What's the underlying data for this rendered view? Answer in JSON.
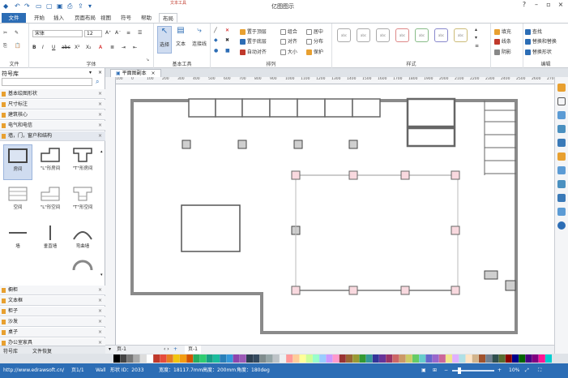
{
  "app_title": "亿图图示",
  "context_tab": "文本工具",
  "menu_tabs": [
    "文件",
    "开始",
    "插入",
    "页面布局",
    "视图",
    "符号",
    "帮助",
    "布局"
  ],
  "ribbon": {
    "font_name": "宋体",
    "font_size": "12",
    "groups": [
      "文件",
      "字体",
      "基本工具",
      "排列",
      "样式",
      "编辑"
    ],
    "tools": [
      "选择",
      "文本",
      "连接线"
    ],
    "arrange": [
      "置于顶层",
      "置于底层",
      "自动对齐"
    ],
    "arrange2": [
      "组合",
      "对齐",
      "大小"
    ],
    "arrange3": [
      "居中",
      "分布",
      "保护"
    ],
    "style_items": [
      "填充",
      "线条",
      "阴影"
    ],
    "edit_items": [
      "查找",
      "替换和替换",
      "替换形状"
    ]
  },
  "library": {
    "title": "符号库",
    "search_placeholder": "",
    "categories_top": [
      "基本绘图形状",
      "尺寸标注",
      "建筑核心",
      "电气和电信",
      "墙，门，窗户和结构"
    ],
    "shapes": [
      {
        "label": "房间"
      },
      {
        "label": "\"L\"形房间"
      },
      {
        "label": "\"T\"形房间"
      },
      {
        "label": "空间"
      },
      {
        "label": "\"L\"形空间"
      },
      {
        "label": "\"T\"形空间"
      },
      {
        "label": "墙"
      },
      {
        "label": "垂直墙"
      },
      {
        "label": "弯曲墙"
      }
    ],
    "categories_bottom": [
      "橱柜",
      "文本框",
      "柜子",
      "沙发",
      "桌子",
      "办公室家具"
    ],
    "tabs": [
      "符号库",
      "文件恢复"
    ]
  },
  "document_tab": "平面图副本",
  "ruler_ticks": [
    "100",
    "0",
    "100",
    "200",
    "300",
    "400",
    "500",
    "600",
    "700",
    "800",
    "900",
    "1000",
    "1100",
    "1200",
    "1300",
    "1400",
    "1500",
    "1600",
    "1700",
    "1800",
    "1900",
    "2000",
    "2100",
    "2200",
    "2300",
    "2400",
    "2500",
    "2600",
    "2700"
  ],
  "page_tabs": [
    "页-1",
    "页-1"
  ],
  "status": {
    "url": "http://www.edrawsoft.cn/",
    "page": "页1/1",
    "shape": "Wall",
    "shape_id": "形状 ID：2033",
    "width": "宽度：18117.7mm",
    "height": "高度：200mm",
    "angle": "角度：180deg",
    "zoom": "10%"
  },
  "colors": {
    "accent": "#2c6db5",
    "selection": "#f9d9df",
    "wall": "#8a8a8a"
  }
}
